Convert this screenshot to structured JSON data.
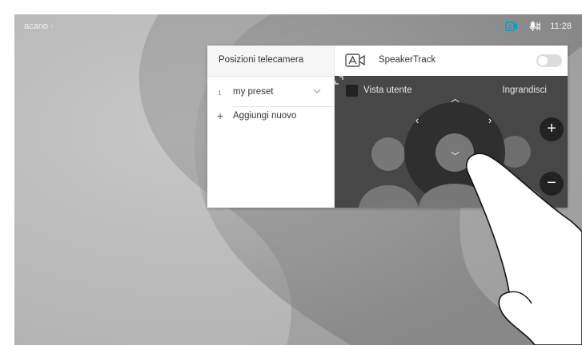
{
  "status_bar": {
    "location": "acano",
    "time": "11:28",
    "icons": [
      "camera-status-icon",
      "microphone-status-icon"
    ]
  },
  "presets": {
    "title": "Posizioni telecamera",
    "items": [
      {
        "number": "1",
        "name": "my preset"
      }
    ],
    "add_label": "Aggiungi nuovo"
  },
  "camera": {
    "speakertrack_label": "SpeakerTrack",
    "speakertrack_on": false,
    "self_view_label": "Vista utente",
    "zoom_label": "Ingrandisci",
    "zoom_in_symbol": "+",
    "zoom_out_symbol": "−"
  },
  "colors": {
    "accent": "#00a0d1",
    "panel_dark": "#444444"
  }
}
